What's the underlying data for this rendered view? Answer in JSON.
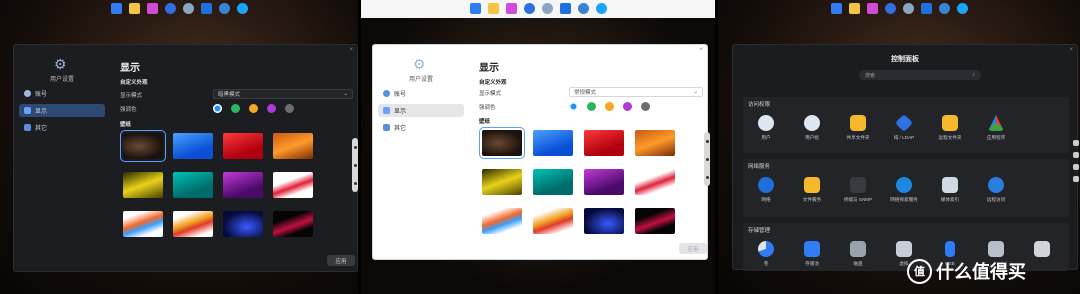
{
  "colors": {
    "accent": "#2f7cf6",
    "blue": "#1e90ff",
    "green": "#2db55d",
    "orange": "#f5a623",
    "purple": "#b03ad6",
    "gray": "#6e6e6e"
  },
  "taskbar": {
    "icons": [
      "grid-app-icon",
      "folder-icon",
      "photo-app-icon",
      "clock-icon",
      "gear-icon",
      "docs-icon",
      "shield-app-icon",
      "headset-icon"
    ]
  },
  "panel1": {
    "app_title": "用户设置",
    "nav": [
      {
        "label": "账号",
        "icon": "user-icon"
      },
      {
        "label": "显示",
        "icon": "display-icon"
      },
      {
        "label": "其它",
        "icon": "apps-icon"
      }
    ],
    "title": "显示",
    "custom_label": "自定义外观",
    "mode_label": "显示模式",
    "mode_value": "暗黑模式",
    "accent_label": "强调色",
    "wallpaper_label": "壁纸",
    "apply_button": "应用"
  },
  "panel2": {
    "app_title": "用户设置",
    "nav": [
      {
        "label": "账号",
        "icon": "user-icon"
      },
      {
        "label": "显示",
        "icon": "display-icon"
      },
      {
        "label": "其它",
        "icon": "apps-icon"
      }
    ],
    "title": "显示",
    "custom_label": "自定义外观",
    "mode_label": "显示模式",
    "mode_value": "常规模式",
    "accent_label": "强调色",
    "wallpaper_label": "壁纸",
    "apply_button": "应用"
  },
  "panel3": {
    "title": "控制面板",
    "search_placeholder": "搜索",
    "sections": [
      {
        "title": "访问权限",
        "items": [
          {
            "label": "用户",
            "icon": "user-icon"
          },
          {
            "label": "用户组",
            "icon": "user-group-icon"
          },
          {
            "label": "共享文件夹",
            "icon": "folder-icon"
          },
          {
            "label": "域 / LDAP",
            "icon": "domain-icon"
          },
          {
            "label": "远程文件夹",
            "icon": "remote-folder-icon"
          },
          {
            "label": "应用程序",
            "icon": "apps-icon"
          }
        ]
      },
      {
        "title": "网络服务",
        "items": [
          {
            "label": "网络",
            "icon": "globe-icon"
          },
          {
            "label": "文件服务",
            "icon": "file-service-icon"
          },
          {
            "label": "终端与 SNMP",
            "icon": "terminal-icon"
          },
          {
            "label": "网络探索服务",
            "icon": "discovery-icon"
          },
          {
            "label": "媒体索引",
            "icon": "media-index-icon"
          },
          {
            "label": "远程访问",
            "icon": "cloud-access-icon"
          }
        ]
      },
      {
        "title": "存储管理",
        "items": [
          {
            "label": "卷",
            "icon": "volume-icon"
          },
          {
            "label": "存储池",
            "icon": "storage-pool-icon"
          },
          {
            "label": "磁盘",
            "icon": "disk-icon"
          },
          {
            "label": "虚拟",
            "icon": "virtual-disk-icon"
          },
          {
            "label": "USB",
            "icon": "usb-icon"
          },
          {
            "label": "",
            "icon": "hdd-icon"
          },
          {
            "label": "",
            "icon": "server-icon"
          }
        ]
      }
    ]
  },
  "watermark": {
    "text": "什么值得买",
    "logo": "值"
  }
}
